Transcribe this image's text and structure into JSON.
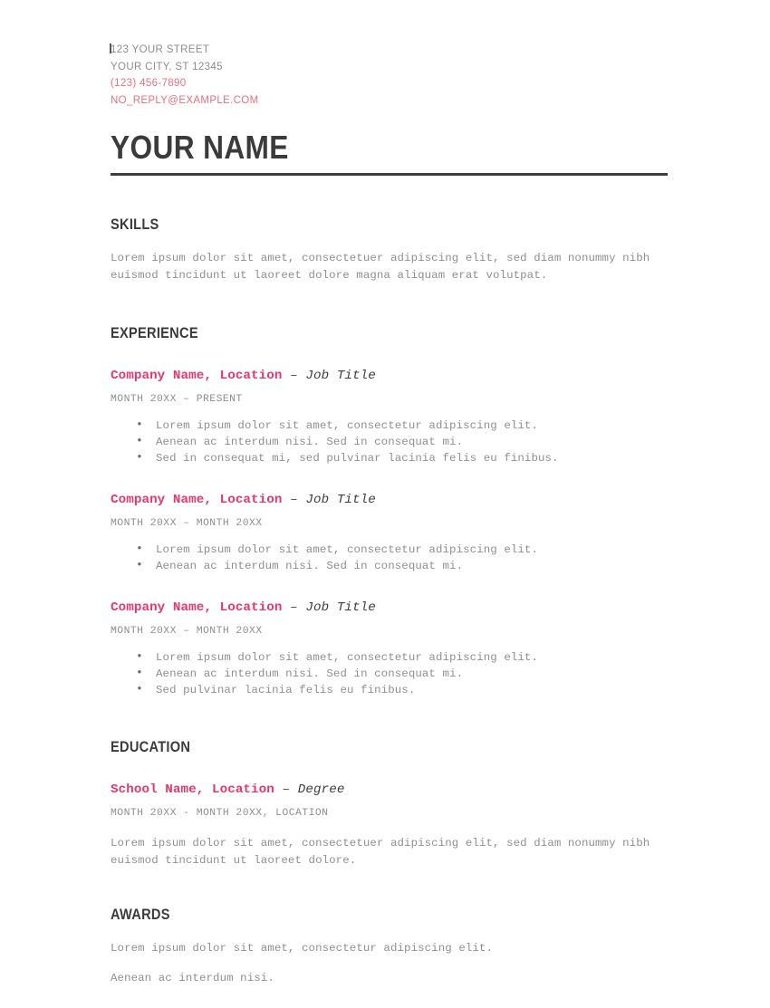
{
  "document": {
    "type": "resume",
    "accent_color": "#e5376c",
    "contact_accent_color": "#e8707f",
    "muted_color": "#8f8f8f",
    "heading_color": "#3b3b3b"
  },
  "contact": {
    "street": "123 YOUR STREET",
    "city_state_zip": "YOUR CITY, ST 12345",
    "phone": "(123) 456-7890",
    "email": "NO_REPLY@EXAMPLE.COM"
  },
  "name": "YOUR NAME",
  "sections": {
    "skills": {
      "title": "SKILLS",
      "body": "Lorem ipsum dolor sit amet, consectetuer adipiscing elit, sed diam nonummy nibh euismod tincidunt ut laoreet dolore magna aliquam erat volutpat."
    },
    "experience": {
      "title": "EXPERIENCE",
      "entries": [
        {
          "org": "Company Name, Location",
          "separator": " – ",
          "role": "Job Title",
          "dates": "MONTH 20XX – PRESENT",
          "bullets": [
            "Lorem ipsum dolor sit amet, consectetur adipiscing elit.",
            "Aenean ac interdum nisi. Sed in consequat mi.",
            "Sed in consequat mi, sed pulvinar lacinia felis eu finibus."
          ]
        },
        {
          "org": "Company Name, Location",
          "separator": " – ",
          "role": "Job Title",
          "dates": "MONTH 20XX – MONTH 20XX",
          "bullets": [
            "Lorem ipsum dolor sit amet, consectetur adipiscing elit.",
            "Aenean ac interdum nisi. Sed in consequat mi."
          ]
        },
        {
          "org": "Company Name, Location",
          "separator": " – ",
          "role": "Job Title",
          "dates": "MONTH 20XX – MONTH 20XX",
          "bullets": [
            "Lorem ipsum dolor sit amet, consectetur adipiscing elit.",
            "Aenean ac interdum nisi. Sed in consequat mi.",
            "Sed pulvinar lacinia felis eu finibus."
          ]
        }
      ]
    },
    "education": {
      "title": "EDUCATION",
      "entry": {
        "org": "School Name, Location",
        "separator": " – ",
        "role": "Degree",
        "dates": "MONTH 20XX - MONTH 20XX, LOCATION",
        "description": "Lorem ipsum dolor sit amet, consectetuer adipiscing elit, sed diam nonummy nibh euismod tincidunt ut laoreet dolore."
      }
    },
    "awards": {
      "title": "AWARDS",
      "lines": [
        "Lorem ipsum dolor sit amet, consectetur adipiscing elit.",
        "Aenean ac interdum nisi."
      ]
    }
  }
}
